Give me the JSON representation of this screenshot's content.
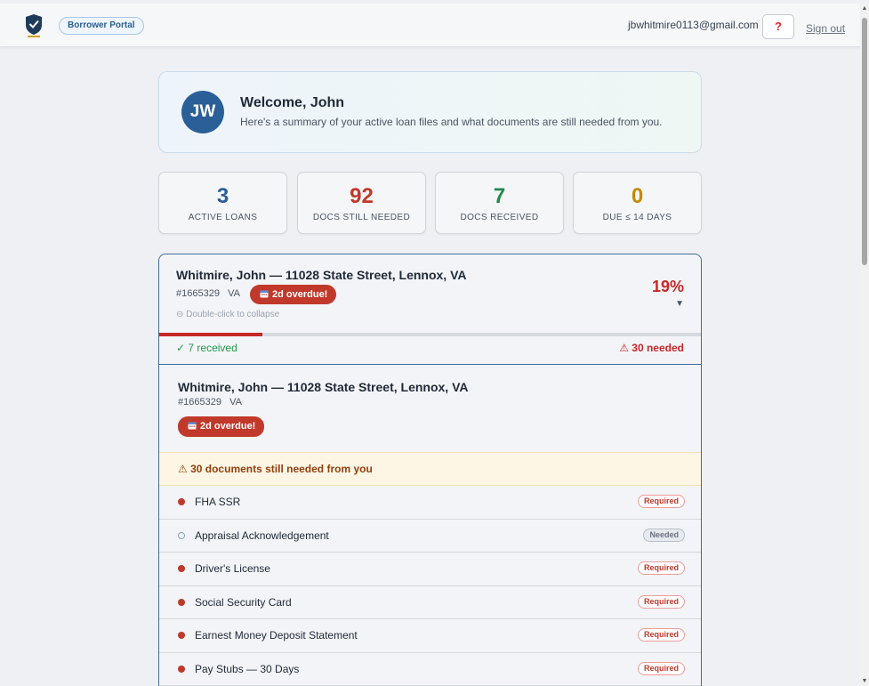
{
  "header": {
    "logo_name": "shield-logo",
    "portal_label": "Borrower Portal",
    "email": "jbwhitmire0113@gmail.com",
    "help_label": "?",
    "signout_label": "Sign out"
  },
  "welcome": {
    "initials": "JW",
    "title": "Welcome, John",
    "subtitle": "Here's a summary of your active loan files and what documents are still needed from you."
  },
  "stats": [
    {
      "value": "3",
      "label": "ACTIVE LOANS",
      "color": "#2b5f97"
    },
    {
      "value": "92",
      "label": "DOCS STILL NEEDED",
      "color": "#c0392b"
    },
    {
      "value": "7",
      "label": "DOCS RECEIVED",
      "color": "#1e8b4a"
    },
    {
      "value": "0",
      "label": "DUE ≤ 14 DAYS",
      "color": "#c48a00"
    }
  ],
  "loan": {
    "title": "Whitmire, John — 11028 State Street, Lennox, VA",
    "number": "#1665329",
    "type": "VA",
    "overdue_label": "2d overdue!",
    "collapse_hint": "Double-click to collapse",
    "percent_label": "19%",
    "percent": 19,
    "caret": "▼",
    "received_label": "✓ 7 received",
    "needed_label": "⚠ 30 needed",
    "detail_title": "Whitmire, John — 11028 State Street, Lennox, VA",
    "detail_meta": "#1665329   VA",
    "banner": "⚠ 30 documents still needed from you",
    "documents": [
      {
        "name": "FHA SSR",
        "status": "Required"
      },
      {
        "name": "Appraisal Acknowledgement",
        "status": "Needed"
      },
      {
        "name": "Driver's License",
        "status": "Required"
      },
      {
        "name": "Social Security Card",
        "status": "Required"
      },
      {
        "name": "Earnest Money Deposit Statement",
        "status": "Required"
      },
      {
        "name": "Pay Stubs — 30 Days",
        "status": "Required"
      },
      {
        "name": "",
        "status": ""
      }
    ]
  },
  "colors": {
    "accent": "#2b5f97",
    "danger": "#c0392b",
    "success": "#1e8b4a"
  }
}
